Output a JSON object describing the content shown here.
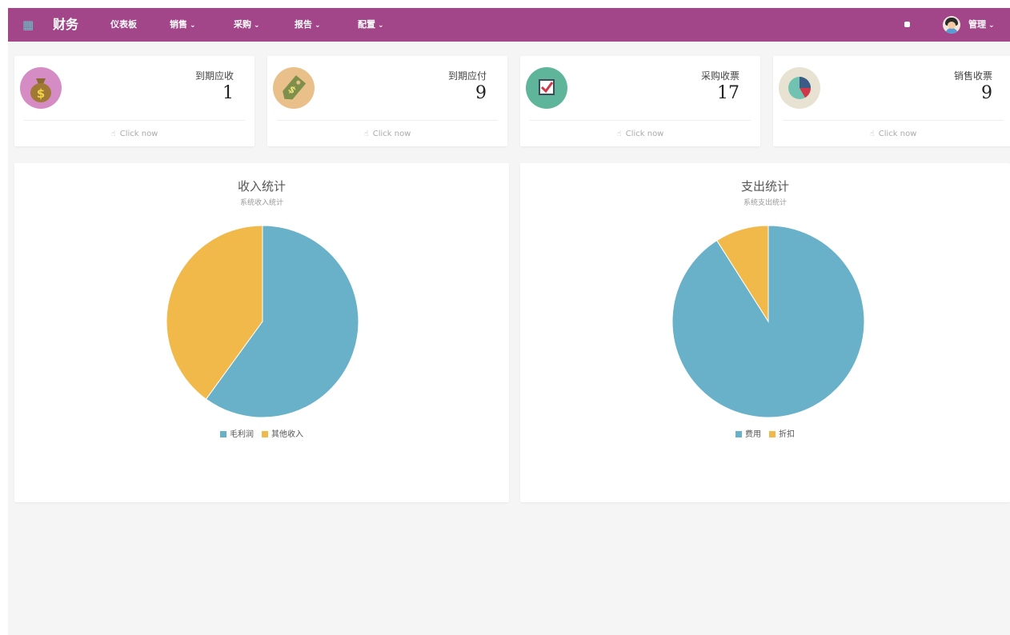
{
  "nav": {
    "brand": "财务",
    "items": [
      {
        "label": "仪表板",
        "dropdown": false
      },
      {
        "label": "销售",
        "dropdown": true
      },
      {
        "label": "采购",
        "dropdown": true
      },
      {
        "label": "报告",
        "dropdown": true
      },
      {
        "label": "配置",
        "dropdown": true
      }
    ],
    "user": "管理",
    "chevron": "⌄"
  },
  "cards": [
    {
      "title": "到期应收",
      "value": "1",
      "link": "Click now",
      "icon": "money-bag-icon",
      "icon_bg": "#d58cc5"
    },
    {
      "title": "到期应付",
      "value": "9",
      "link": "Click now",
      "icon": "price-tag-icon",
      "icon_bg": "#e9c08a"
    },
    {
      "title": "采购收票",
      "value": "17",
      "link": "Click now",
      "icon": "checkbox-icon",
      "icon_bg": "#5fb59a"
    },
    {
      "title": "销售收票",
      "value": "9",
      "link": "Click now",
      "icon": "pie-chart-icon",
      "icon_bg": "#e8e2d2"
    }
  ],
  "charts": {
    "income": {
      "title": "收入统计",
      "subtitle": "系统收入统计"
    },
    "expense": {
      "title": "支出统计",
      "subtitle": "系统支出统计"
    }
  },
  "chart_data": [
    {
      "type": "pie",
      "title": "收入统计",
      "subtitle": "系统收入统计",
      "series": [
        {
          "name": "毛利润",
          "value": 60,
          "color": "#68b1c9"
        },
        {
          "name": "其他收入",
          "value": 40,
          "color": "#f1b94a"
        }
      ]
    },
    {
      "type": "pie",
      "title": "支出统计",
      "subtitle": "系统支出统计",
      "series": [
        {
          "name": "费用",
          "value": 91,
          "color": "#68b1c9"
        },
        {
          "name": "折扣",
          "value": 9,
          "color": "#f1b94a"
        }
      ]
    }
  ]
}
